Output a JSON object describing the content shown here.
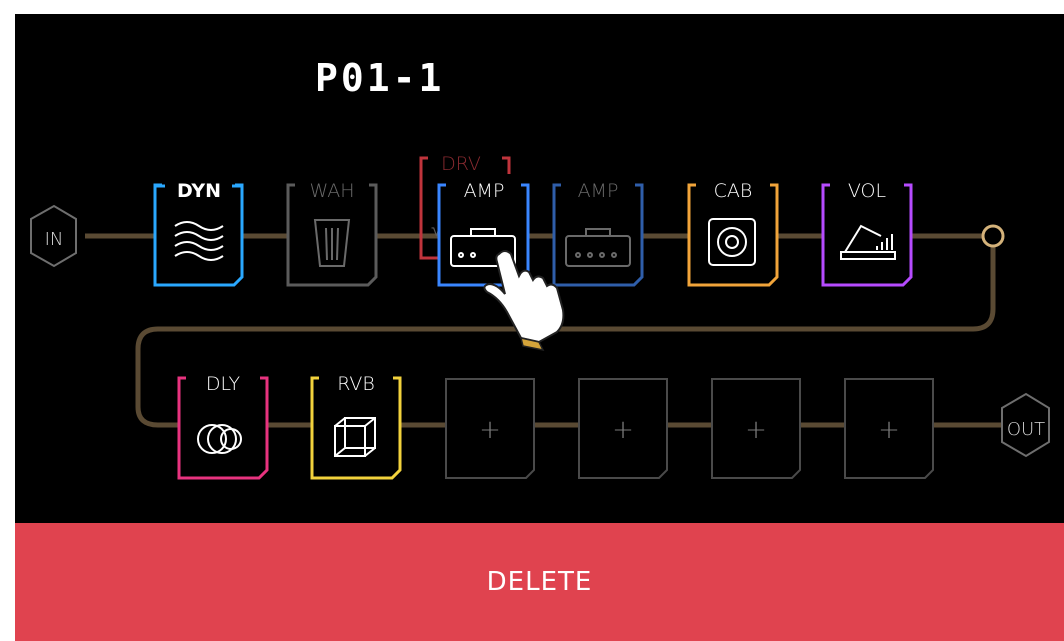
{
  "preset_name": "P01-1",
  "input_label": "IN",
  "output_label": "OUT",
  "delete_label": "DELETE",
  "blocks": {
    "dyn": "DYN",
    "wah": "WAH",
    "drv": "DRV",
    "amp1": "AMP",
    "amp2": "AMP",
    "cab": "CAB",
    "vol": "VOL",
    "dly": "DLY",
    "rvb": "RVB"
  },
  "empty_slot_symbol": "+",
  "colors": {
    "background": "#000000",
    "cable": "#5a4a33",
    "dyn": "#2aa8ff",
    "wah": "#5b5b5b",
    "drv": "#c0343c",
    "amp_active": "#3a86ff",
    "amp_inactive": "#2f5eaa",
    "cab": "#f1a43a",
    "vol": "#b64bff",
    "dly": "#e8337f",
    "rvb": "#f2d23c",
    "empty": "#4a4a4a",
    "delete_bar": "#e0434f"
  },
  "cursor_icon": "hand-pointer-icon"
}
